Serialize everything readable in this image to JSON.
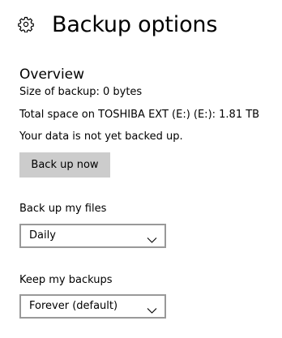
{
  "header": {
    "icon": "gear-icon",
    "title": "Backup options"
  },
  "overview": {
    "title": "Overview",
    "size_line": "Size of backup: 0 bytes",
    "space_line": "Total space on TOSHIBA EXT (E:) (E:): 1.81 TB",
    "status_line": "Your data is not yet backed up.",
    "backup_button_label": "Back up now"
  },
  "backup_frequency": {
    "label": "Back up my files",
    "selected": "Daily"
  },
  "retention": {
    "label": "Keep my backups",
    "selected": "Forever (default)"
  },
  "colors": {
    "button_bg": "#cccccc",
    "select_border": "#999999",
    "text": "#000000",
    "background": "#ffffff"
  }
}
